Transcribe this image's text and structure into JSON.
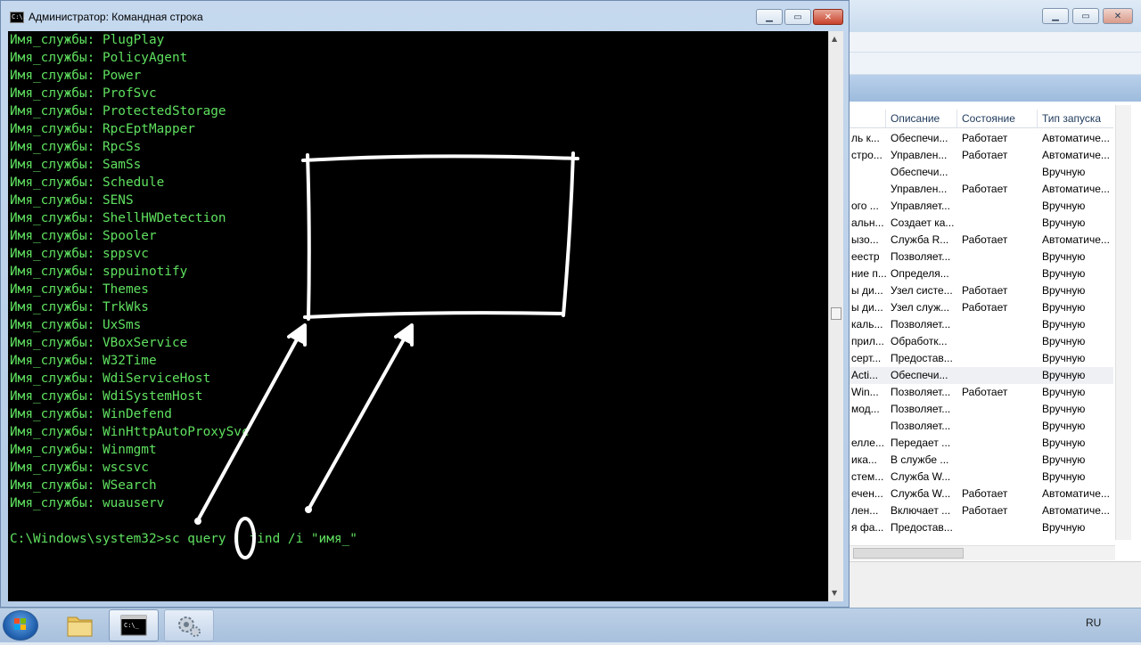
{
  "colors": {
    "console_text": "#5fe05f",
    "console_background": "#000000",
    "annotation_white": "#ffffff",
    "close_button": "#c8412a"
  },
  "cmd_window": {
    "title": "Администратор: Командная строка",
    "icon_label": "C:\\.",
    "minimize_icon": "minimize-icon",
    "maximize_icon": "maximize-icon",
    "close_icon": "close-icon",
    "output_lines": [
      "Имя_службы: PlugPlay",
      "Имя_службы: PolicyAgent",
      "Имя_службы: Power",
      "Имя_службы: ProfSvc",
      "Имя_службы: ProtectedStorage",
      "Имя_службы: RpcEptMapper",
      "Имя_службы: RpcSs",
      "Имя_службы: SamSs",
      "Имя_службы: Schedule",
      "Имя_службы: SENS",
      "Имя_службы: ShellHWDetection",
      "Имя_службы: Spooler",
      "Имя_службы: sppsvc",
      "Имя_службы: sppuinotify",
      "Имя_службы: Themes",
      "Имя_службы: TrkWks",
      "Имя_службы: UxSms",
      "Имя_службы: VBoxService",
      "Имя_службы: W32Time",
      "Имя_службы: WdiServiceHost",
      "Имя_службы: WdiSystemHost",
      "Имя_службы: WinDefend",
      "Имя_службы: WinHttpAutoProxySvc",
      "Имя_службы: Winmgmt",
      "Имя_службы: wscsvc",
      "Имя_службы: WSearch",
      "Имя_службы: wuauserv"
    ],
    "prompt": "C:\\Windows\\system32>sc query | find /i \"имя_\""
  },
  "services_window": {
    "minimize_icon": "minimize-icon",
    "maximize_icon": "maximize-icon",
    "close_icon": "close-icon",
    "columns": [
      "Описание",
      "Состояние",
      "Тип запуска"
    ],
    "rows": [
      [
        "ль к...",
        "Обеспечи...",
        "Работает",
        "Автоматиче..."
      ],
      [
        "стро...",
        "Управлен...",
        "Работает",
        "Автоматиче..."
      ],
      [
        "",
        "Обеспечи...",
        "",
        "Вручную"
      ],
      [
        "",
        "Управлен...",
        "Работает",
        "Автоматиче..."
      ],
      [
        "ого ...",
        "Управляет...",
        "",
        "Вручную"
      ],
      [
        "альн...",
        "Создает ка...",
        "",
        "Вручную"
      ],
      [
        "ызо...",
        "Служба R...",
        "Работает",
        "Автоматиче..."
      ],
      [
        "еестр",
        "Позволяет...",
        "",
        "Вручную"
      ],
      [
        "ние п...",
        "Определя...",
        "",
        "Вручную"
      ],
      [
        "ы ди...",
        "Узел систе...",
        "Работает",
        "Вручную"
      ],
      [
        "ы ди...",
        "Узел служ...",
        "Работает",
        "Вручную"
      ],
      [
        "каль...",
        "Позволяет...",
        "",
        "Вручную"
      ],
      [
        "прил...",
        "Обработк...",
        "",
        "Вручную"
      ],
      [
        "серт...",
        "Предостав...",
        "",
        "Вручную"
      ],
      [
        "Acti...",
        "Обеспечи...",
        "",
        "Вручную"
      ],
      [
        "Win...",
        "Позволяет...",
        "Работает",
        "Вручную"
      ],
      [
        "мод...",
        "Позволяет...",
        "",
        "Вручную"
      ],
      [
        "",
        "Позволяет...",
        "",
        "Вручную"
      ],
      [
        "елле...",
        "Передает ...",
        "",
        "Вручную"
      ],
      [
        "ика...",
        "В службе ...",
        "",
        "Вручную"
      ],
      [
        "стем...",
        "Служба W...",
        "",
        "Вручную"
      ],
      [
        "ечен...",
        "Служба W...",
        "Работает",
        "Автоматиче..."
      ],
      [
        "лен...",
        "Включает ...",
        "Работает",
        "Автоматиче..."
      ],
      [
        "я фа...",
        "Предостав...",
        "",
        "Вручную"
      ]
    ],
    "highlighted_row": 14
  },
  "taskbar": {
    "start_icon": "windows-start-icon",
    "items": [
      {
        "name": "explorer",
        "icon": "folder-icon"
      },
      {
        "name": "cmd",
        "icon": "console-icon",
        "active": true
      },
      {
        "name": "services",
        "icon": "gears-icon"
      }
    ],
    "language": "RU"
  }
}
